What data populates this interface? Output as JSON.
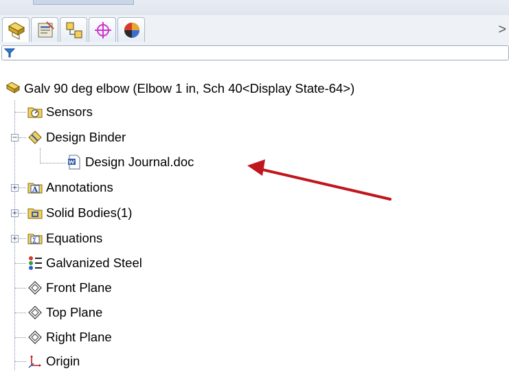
{
  "tabs": [
    {
      "name": "featuremanager-tab"
    },
    {
      "name": "propertymanager-tab"
    },
    {
      "name": "configurationmanager-tab"
    },
    {
      "name": "dimxpert-tab"
    },
    {
      "name": "display-manager-tab"
    }
  ],
  "overflow_chevron": ">",
  "tree": {
    "root_label": "Galv 90 deg elbow  (Elbow 1 in, Sch 40<Display State-64>)",
    "items": [
      {
        "label": "Sensors",
        "icon": "sensors-icon"
      },
      {
        "label": "Design Binder",
        "icon": "design-binder-icon",
        "expanded": true
      },
      {
        "label": "Design Journal.doc",
        "icon": "word-document-icon",
        "child": true
      },
      {
        "label": "Annotations",
        "icon": "annotations-icon"
      },
      {
        "label": "Solid Bodies(1)",
        "icon": "solid-bodies-icon"
      },
      {
        "label": "Equations",
        "icon": "equations-icon"
      },
      {
        "label": "Galvanized Steel",
        "icon": "material-icon"
      },
      {
        "label": "Front Plane",
        "icon": "plane-icon"
      },
      {
        "label": "Top Plane",
        "icon": "plane-icon"
      },
      {
        "label": "Right Plane",
        "icon": "plane-icon"
      },
      {
        "label": "Origin",
        "icon": "origin-icon"
      }
    ]
  },
  "colors": {
    "arrow": "#c0161d",
    "folder": "#f3cf5b",
    "tree_line": "#7a8ea8"
  }
}
